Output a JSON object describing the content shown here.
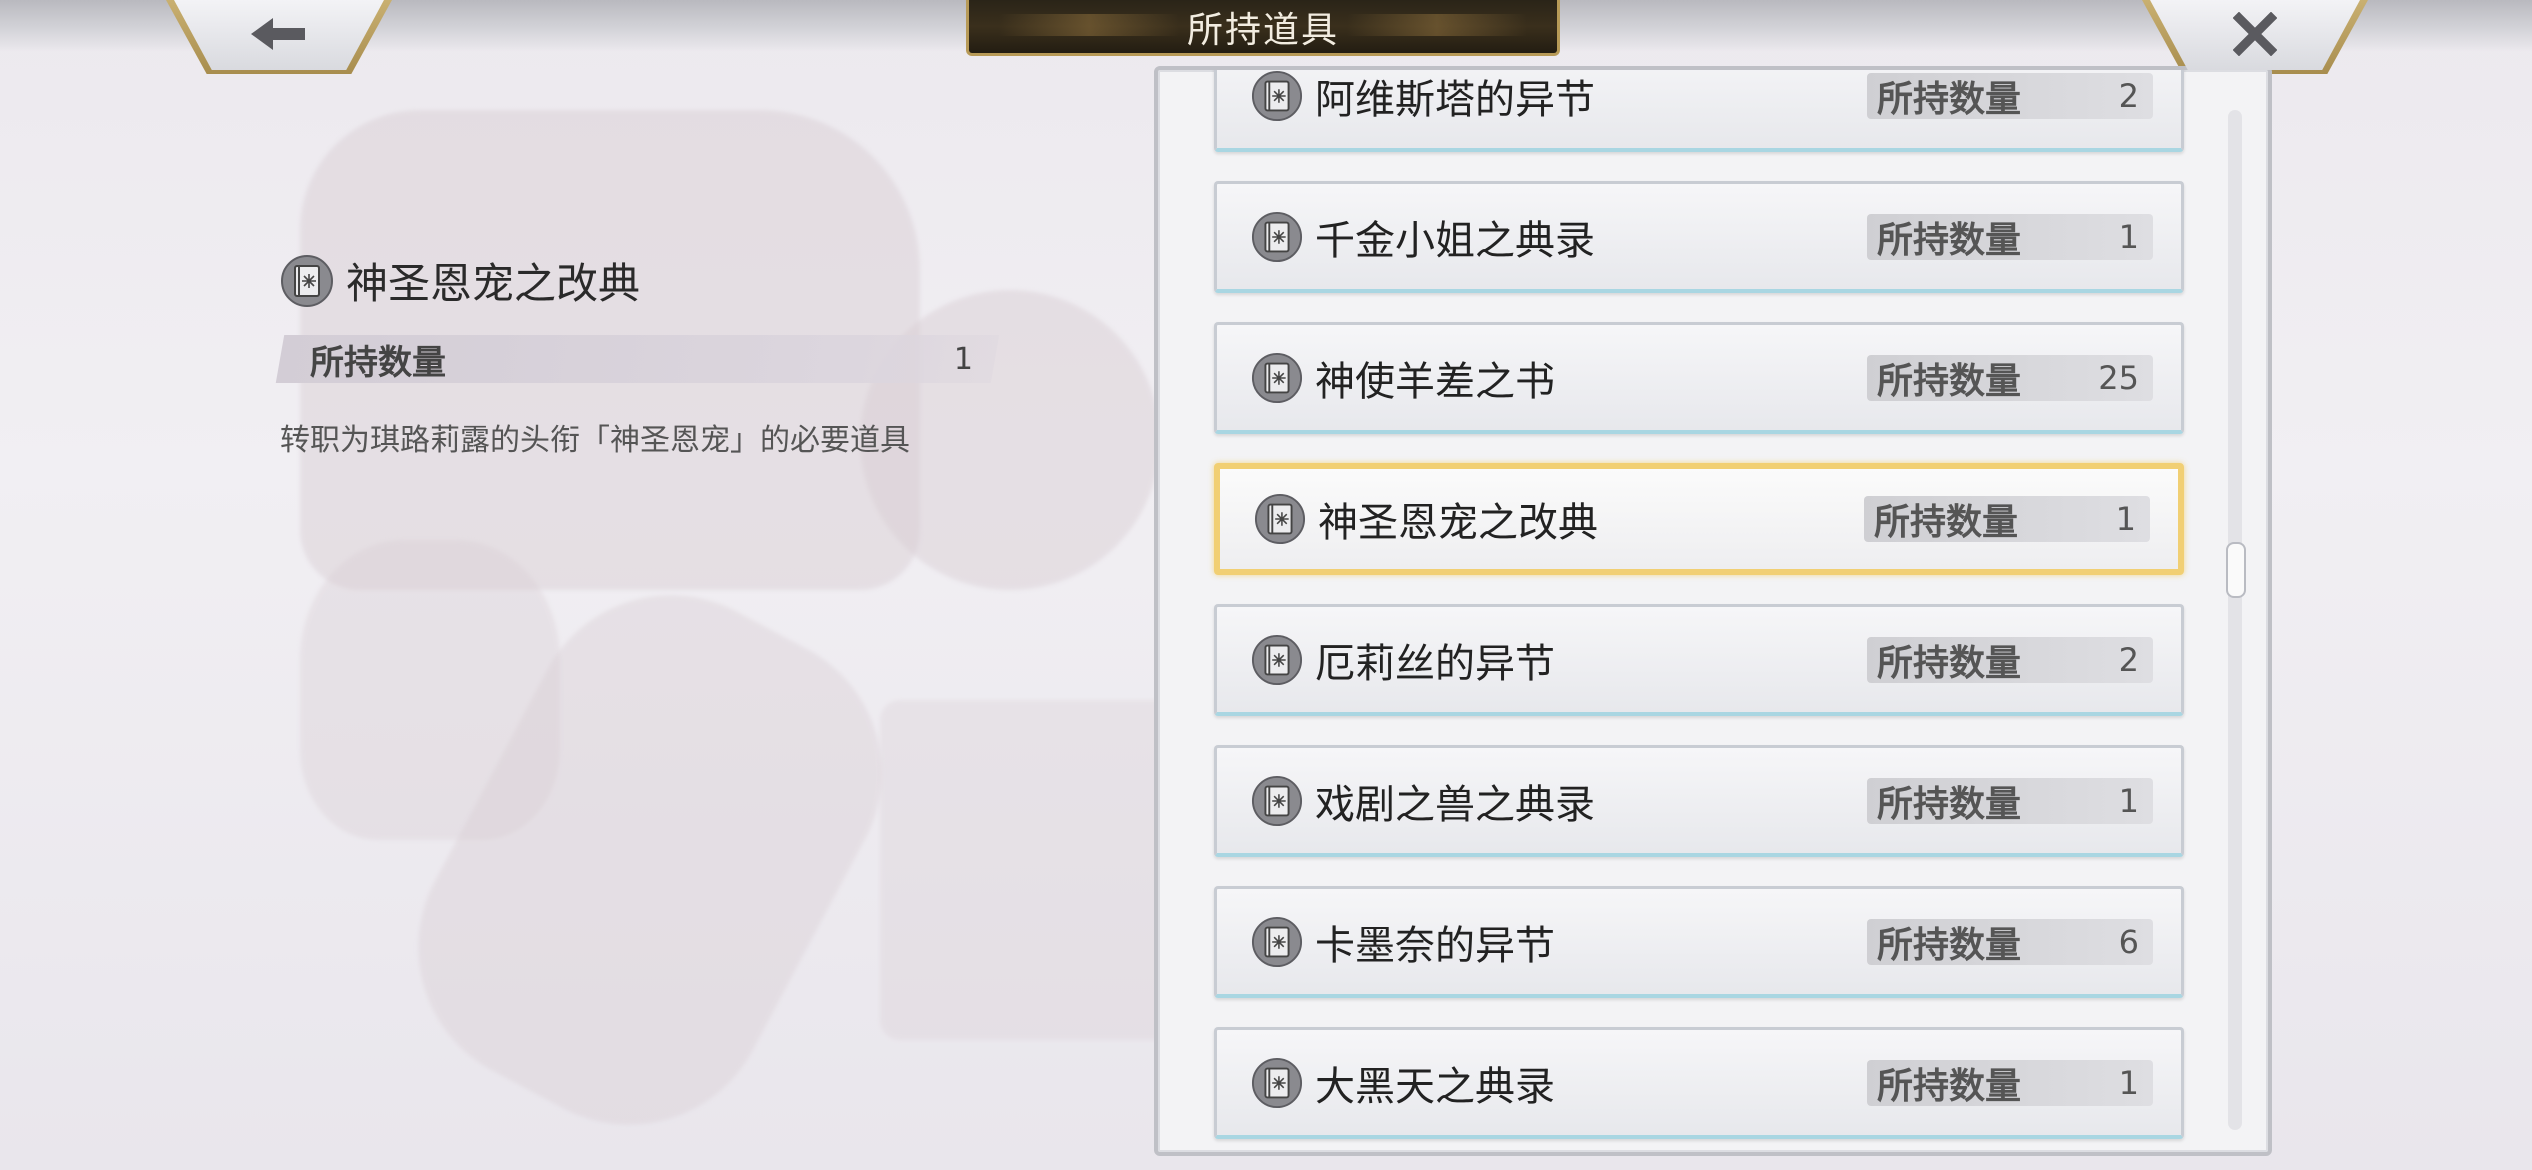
{
  "header": {
    "title": "所持道具"
  },
  "buttons": {
    "back_icon": "arrow-left-icon",
    "close_icon": "close-icon"
  },
  "detail": {
    "name": "神圣恩宠之改典",
    "qty_label": "所持数量",
    "qty_value": "1",
    "description": "转职为琪路莉露的头衔「神圣恩宠」的必要道具"
  },
  "items": [
    {
      "name": "阿维斯塔的异节",
      "qty_label": "所持数量",
      "qty": "2",
      "partial": true
    },
    {
      "name": "千金小姐之典录",
      "qty_label": "所持数量",
      "qty": "1"
    },
    {
      "name": "神使羊差之书",
      "qty_label": "所持数量",
      "qty": "25"
    },
    {
      "name": "神圣恩宠之改典",
      "qty_label": "所持数量",
      "qty": "1",
      "selected": true
    },
    {
      "name": "厄莉丝的异节",
      "qty_label": "所持数量",
      "qty": "2"
    },
    {
      "name": "戏剧之兽之典录",
      "qty_label": "所持数量",
      "qty": "1"
    },
    {
      "name": "卡墨奈的异节",
      "qty_label": "所持数量",
      "qty": "6"
    },
    {
      "name": "大黑天之典录",
      "qty_label": "所持数量",
      "qty": "1"
    }
  ],
  "colors": {
    "selected_border": "#f1cf73",
    "accent_gold": "#b79a57"
  }
}
